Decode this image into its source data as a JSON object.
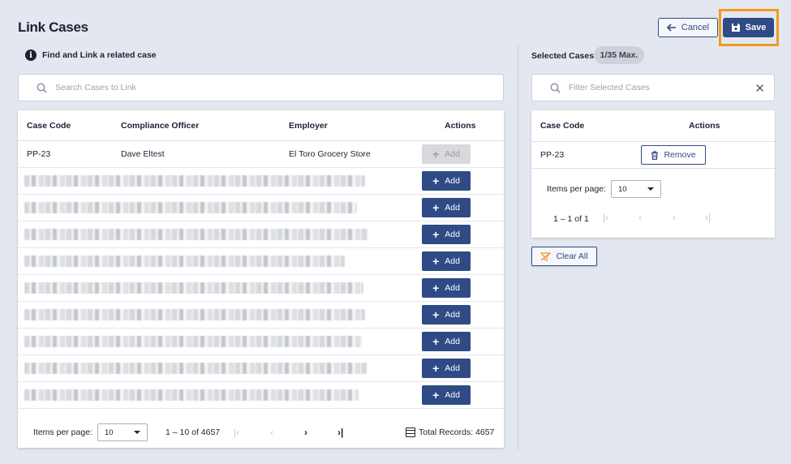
{
  "page": {
    "title": "Link Cases"
  },
  "header": {
    "cancel_label": "Cancel",
    "save_label": "Save"
  },
  "search": {
    "hint": "Find and Link a related case",
    "placeholder": "Search Cases to Link",
    "value": ""
  },
  "results_table": {
    "headers": {
      "code": "Case Code",
      "officer": "Compliance Officer",
      "employer": "Employer",
      "actions": "Actions"
    },
    "rows": [
      {
        "code": "PP-23",
        "officer": "Dave Eltest",
        "employer": "El Toro Grocery Store",
        "action": "Add",
        "disabled": true
      },
      {
        "action": "Add",
        "redacted": true
      },
      {
        "action": "Add",
        "redacted": true
      },
      {
        "action": "Add",
        "redacted": true
      },
      {
        "action": "Add",
        "redacted": true
      },
      {
        "action": "Add",
        "redacted": true
      },
      {
        "action": "Add",
        "redacted": true
      },
      {
        "action": "Add",
        "redacted": true
      },
      {
        "action": "Add",
        "redacted": true
      },
      {
        "action": "Add",
        "redacted": true
      }
    ]
  },
  "results_pager": {
    "items_per_page_label": "Items per page:",
    "items_per_page": "10",
    "range": "1 – 10 of 4657",
    "total_label": "Total Records: 4657"
  },
  "selected": {
    "label": "Selected Cases:",
    "badge": "1/35 Max.",
    "filter_placeholder": "Filter Selected Cases",
    "filter_value": "",
    "headers": {
      "code": "Case Code",
      "actions": "Actions"
    },
    "rows": [
      {
        "code": "PP-23",
        "action": "Remove"
      }
    ],
    "items_per_page_label": "Items per page:",
    "items_per_page": "10",
    "range": "1 – 1 of 1",
    "clear_label": "Clear All"
  },
  "icons": {
    "info": "info-circle-icon",
    "search": "search-icon",
    "close": "close-icon",
    "save": "floppy-disk-icon",
    "back": "arrow-left-icon",
    "trash": "trash-icon",
    "clear": "clear-filter-icon",
    "total": "list-icon"
  },
  "colors": {
    "primary": "#2f4a85",
    "highlight": "#f39a1f",
    "background": "#e3e7ef"
  }
}
